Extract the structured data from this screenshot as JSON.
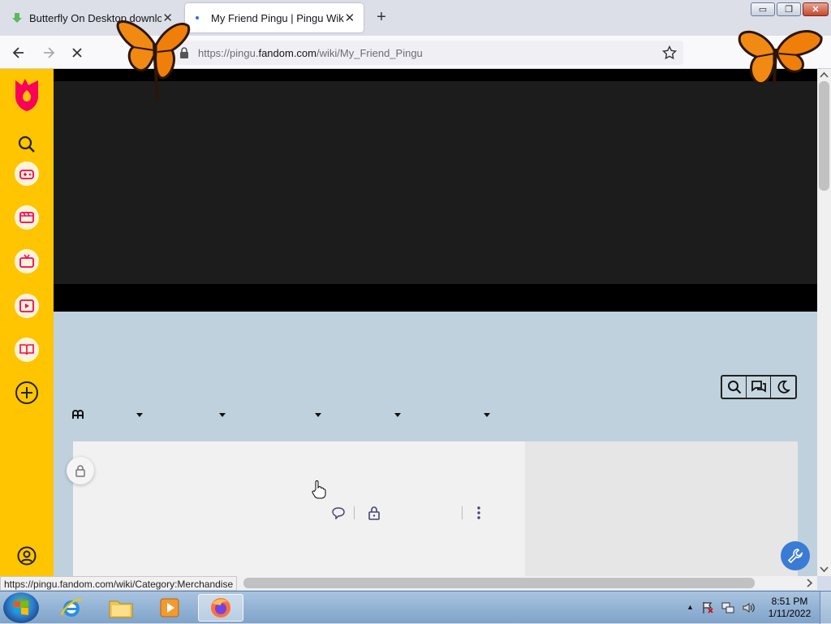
{
  "browser": {
    "tabs": [
      {
        "title": "Butterfly On Desktop download",
        "active": false
      },
      {
        "title": "My Friend Pingu | Pingu Wiki | F",
        "active": true
      }
    ],
    "new_tab": "+",
    "url_prefix": "https://pingu.",
    "url_domain": "fandom.com",
    "url_path": "/wiki/My_Friend_Pingu",
    "status_url": "https://pingu.fandom.com/wiki/Category:Merchandise"
  },
  "window_controls": {
    "minimize": "▭",
    "restore": "❐",
    "close": "✕"
  },
  "fandom_rail": {
    "items": [
      "fandom-logo-icon",
      "search-icon",
      "games-icon",
      "movies-icon",
      "tv-icon",
      "video-icon",
      "books-icon",
      "add-icon",
      "user-icon"
    ],
    "brand_color": "#ffc500",
    "accent_color": "#fa005a"
  },
  "taskbar": {
    "time": "8:51 PM",
    "date": "1/11/2022",
    "apps": [
      "internet-explorer-icon",
      "file-explorer-icon",
      "media-player-icon",
      "firefox-icon"
    ],
    "tray_arrow": "▲"
  }
}
